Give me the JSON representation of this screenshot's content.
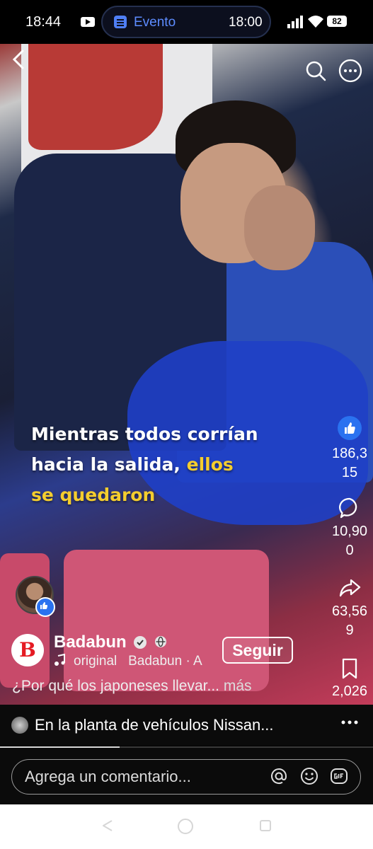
{
  "status_bar": {
    "time": "18:44",
    "event_label": "Evento",
    "event_time": "18:00",
    "battery": "82",
    "icons": [
      "youtube-icon",
      "calendar-icon",
      "signal-icon",
      "wifi-icon",
      "battery-icon"
    ]
  },
  "video": {
    "caption_line1": "Mientras todos corrían",
    "caption_line2_a": "hacia la salida, ",
    "caption_line2_b": "ellos",
    "caption_line3": "se quedaron",
    "highlight_color": "#f4cd2e",
    "progress_fraction": 0.32
  },
  "actions": {
    "likes": "186,315",
    "comments": "10,900",
    "shares": "63,569",
    "saves": "2,026"
  },
  "channel": {
    "logo_letter": "B",
    "name": "Badabun",
    "follow_label": "Seguir",
    "audio_text": "original   Badabun · A",
    "description": "¿Por qué los japoneses llevar...",
    "more_label": "más"
  },
  "related": {
    "title": "En la planta de vehículos Nissan..."
  },
  "composer": {
    "placeholder": "Agrega un comentario..."
  },
  "colors": {
    "accent": "#2a72f0",
    "event_label": "#5d8cff",
    "logo_red": "#e51b23"
  }
}
